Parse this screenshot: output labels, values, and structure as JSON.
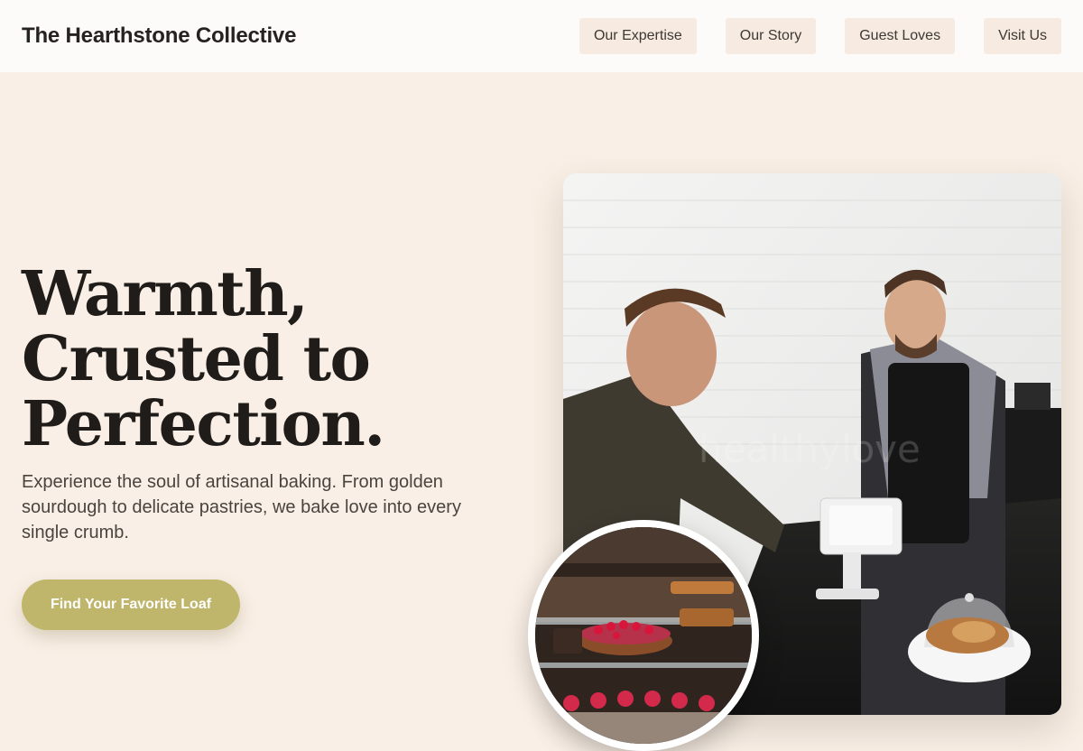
{
  "header": {
    "brand": "The Hearthstone Collective",
    "nav": [
      {
        "label": "Our Expertise"
      },
      {
        "label": "Our Story"
      },
      {
        "label": "Guest Loves"
      },
      {
        "label": "Visit Us"
      }
    ]
  },
  "hero": {
    "headline_lines": [
      "Warmth,",
      "Crusted to",
      "Perfection."
    ],
    "subtext": "Experience the soul of artisanal baking. From golden sourdough to delicate pastries, we bake love into every single crumb.",
    "cta_label": "Find Your Favorite Loaf"
  },
  "images": {
    "main": "bakery-counter-photo",
    "inset": "pastry-display-case-photo"
  },
  "colors": {
    "background": "#f9efe6",
    "header_bg": "#fdfbf9",
    "nav_button_bg": "#f7ebe1",
    "cta_bg": "#bfb56b",
    "text_dark": "#1f1c19"
  }
}
